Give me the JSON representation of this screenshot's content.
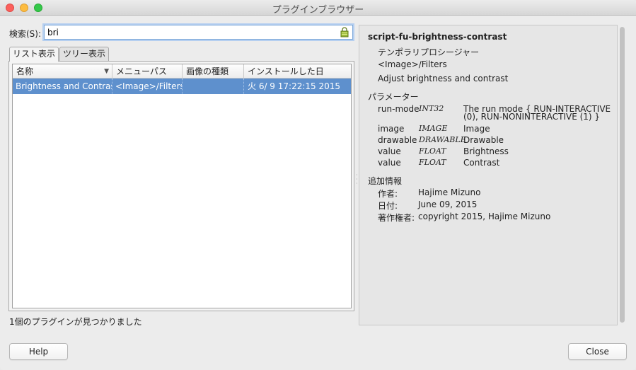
{
  "window": {
    "title": "プラグインブラウザー"
  },
  "search": {
    "label": "検索(S):",
    "value": "bri"
  },
  "tabs": [
    {
      "label": "リスト表示"
    },
    {
      "label": "ツリー表示"
    }
  ],
  "table": {
    "columns": [
      "名称",
      "メニューパス",
      "画像の種類",
      "インストールした日"
    ],
    "rows": [
      {
        "name": "Brightness and Contrast",
        "menu_path": "<Image>/Filters",
        "image_types": "",
        "install_date": "火  6/ 9 17:22:15 2015"
      }
    ]
  },
  "status": "1個のプラグインが見つかりました",
  "detail": {
    "name": "script-fu-brightness-contrast",
    "type": "テンポラリプロシージャー",
    "menu_path": "<Image>/Filters",
    "blurb": "Adjust brightness and contrast",
    "params_heading": "パラメーター",
    "params": [
      {
        "name": "run-mode",
        "type": "INT32",
        "desc_line1": "The run mode { RUN-INTERACTIVE",
        "desc_line2": "(0), RUN-NONINTERACTIVE (1) }"
      },
      {
        "name": "image",
        "type": "IMAGE",
        "desc": "Image"
      },
      {
        "name": "drawable",
        "type": "DRAWABLE",
        "desc": "Drawable"
      },
      {
        "name": "value",
        "type": "FLOAT",
        "desc": "Brightness"
      },
      {
        "name": "value",
        "type": "FLOAT",
        "desc": "Contrast"
      }
    ],
    "extra_heading": "追加情報",
    "author_label": "作者:",
    "author": "Hajime Mizuno",
    "date_label": "日付:",
    "date": "June 09, 2015",
    "copyright_label": "著作権者:",
    "copyright": "copyright 2015, Hajime Mizuno"
  },
  "buttons": {
    "help": "Help",
    "close": "Close"
  },
  "colors": {
    "selection": "#5e90cd",
    "focus_ring": "#b5cff0"
  }
}
